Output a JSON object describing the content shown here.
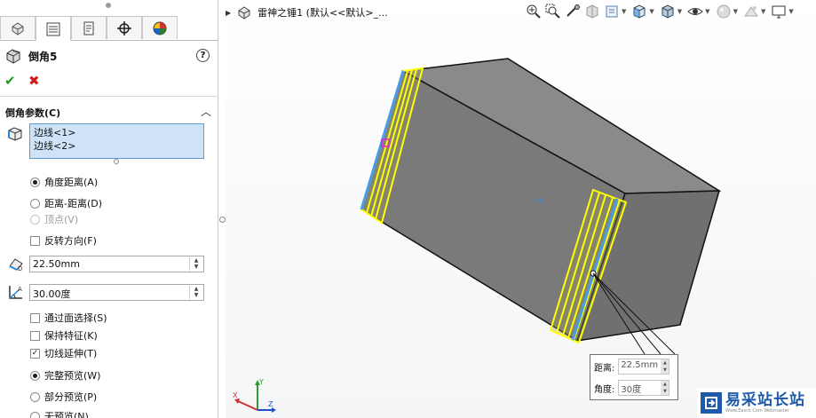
{
  "feature": {
    "title": "倒角5"
  },
  "section": {
    "title": "倒角参数(C)"
  },
  "selection": {
    "items": [
      "边线<1>",
      "边线<2>"
    ]
  },
  "chamfer_type": {
    "options": [
      {
        "label": "角度距离(A)",
        "selected": true,
        "disabled": false
      },
      {
        "label": "距离-距离(D)",
        "selected": false,
        "disabled": false
      },
      {
        "label": "顶点(V)",
        "selected": false,
        "disabled": true
      }
    ]
  },
  "flip_direction": {
    "label": "反转方向(F)",
    "checked": false
  },
  "distance": {
    "value": "22.50mm"
  },
  "angle": {
    "value": "30.00度"
  },
  "checkboxes": [
    {
      "label": "通过面选择(S)",
      "checked": false
    },
    {
      "label": "保持特征(K)",
      "checked": false
    },
    {
      "label": "切线延伸(T)",
      "checked": true
    }
  ],
  "preview": {
    "options": [
      {
        "label": "完整预览(W)",
        "selected": true
      },
      {
        "label": "部分预览(P)",
        "selected": false
      },
      {
        "label": "无预览(N)",
        "selected": false
      }
    ]
  },
  "tree": {
    "root": "雷神之锤1  (默认<<默认>_..."
  },
  "callout": {
    "distance_label": "距离:",
    "distance_value": "22.5mm",
    "angle_label": "角度:",
    "angle_value": "30度"
  },
  "watermark": {
    "text": "易采站长站",
    "sub": "Www.Easck.Com Webmaster"
  },
  "colors": {
    "selection_fill": "#cfe3f8",
    "edge_highlight": "#4a9be6",
    "chamfer_preview": "#ffff00",
    "body_face": "#8c8c8c"
  }
}
